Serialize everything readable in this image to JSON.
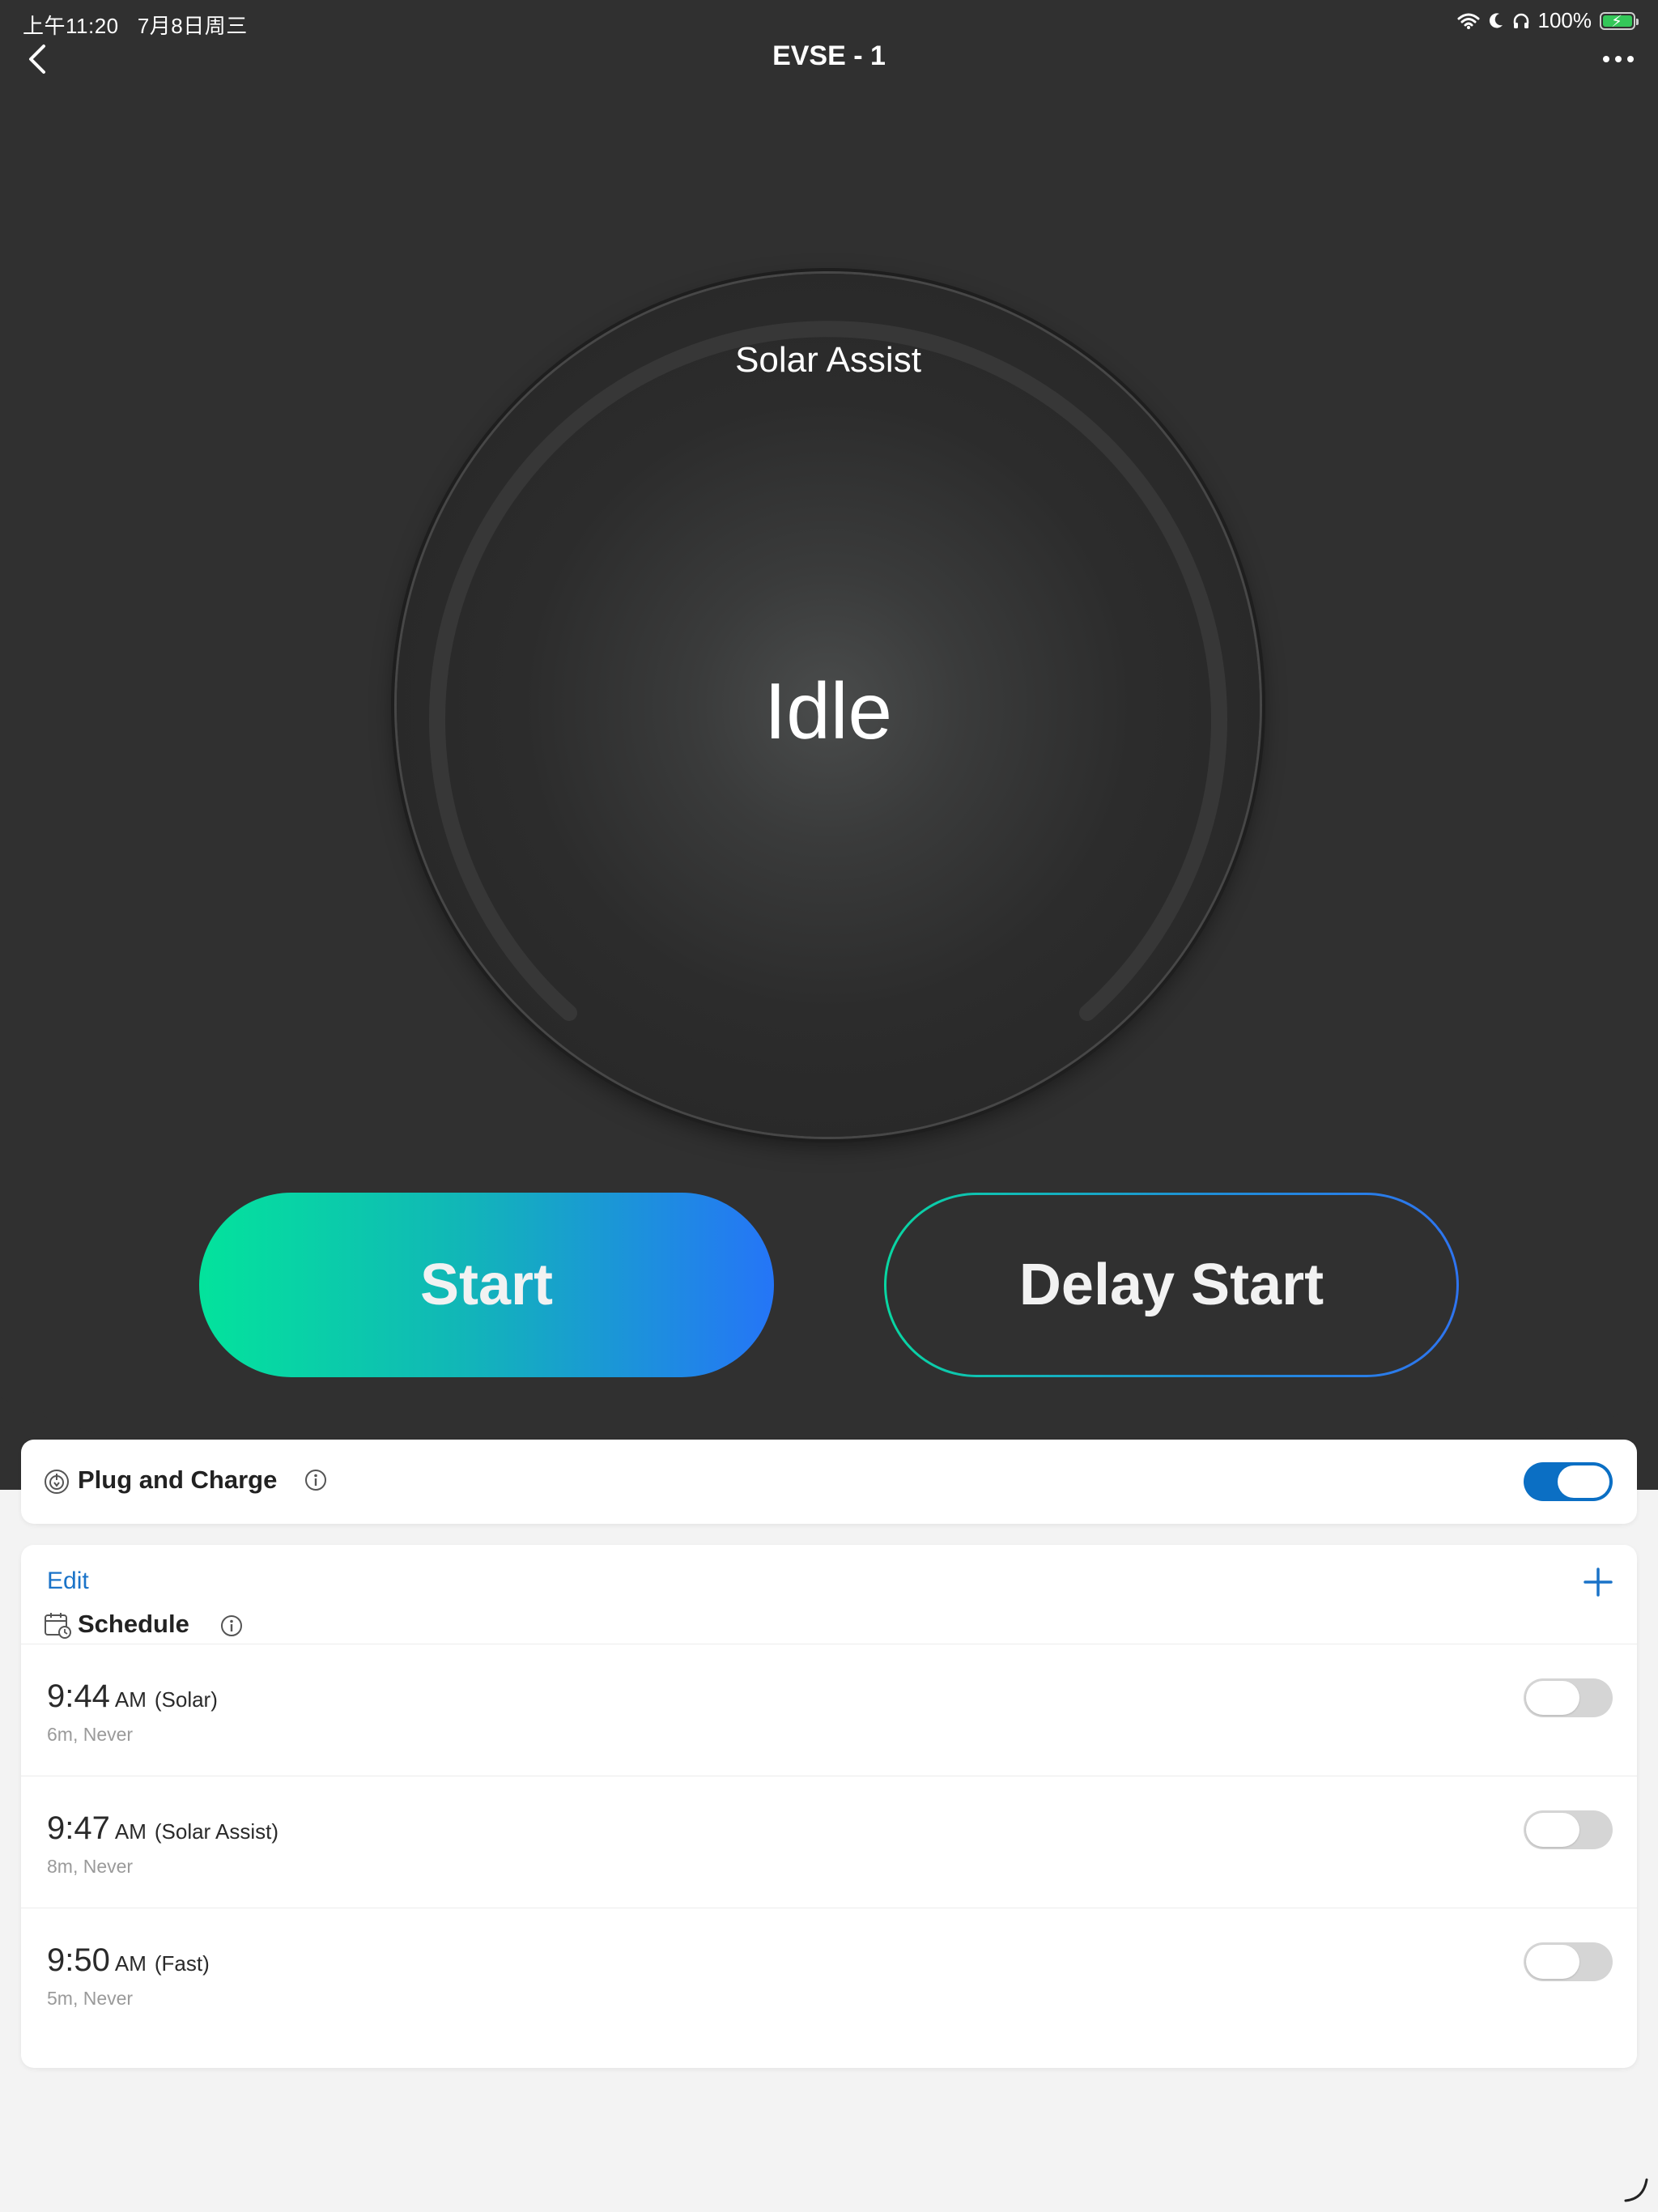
{
  "status_bar": {
    "time": "上午11:20",
    "date": "7月8日周三",
    "battery": "100%"
  },
  "nav": {
    "title": "EVSE - 1"
  },
  "gauge": {
    "mode": "Solar Assist",
    "status": "Idle"
  },
  "actions": {
    "start": "Start",
    "delay_start": "Delay Start"
  },
  "plug_and_charge": {
    "label": "Plug and Charge",
    "enabled": true
  },
  "schedule": {
    "edit_label": "Edit",
    "title": "Schedule",
    "items": [
      {
        "time": "9:44",
        "ampm": "AM",
        "mode": "(Solar)",
        "detail": "6m, Never",
        "enabled": false
      },
      {
        "time": "9:47",
        "ampm": "AM",
        "mode": "(Solar Assist)",
        "detail": "8m, Never",
        "enabled": false
      },
      {
        "time": "9:50",
        "ampm": "AM",
        "mode": "(Fast)",
        "detail": "5m, Never",
        "enabled": false
      }
    ]
  },
  "colors": {
    "background_dark": "#303030",
    "accent_blue": "#0b6fc4",
    "gradient_green": "#03e39c",
    "gradient_blue": "#2575f7"
  }
}
